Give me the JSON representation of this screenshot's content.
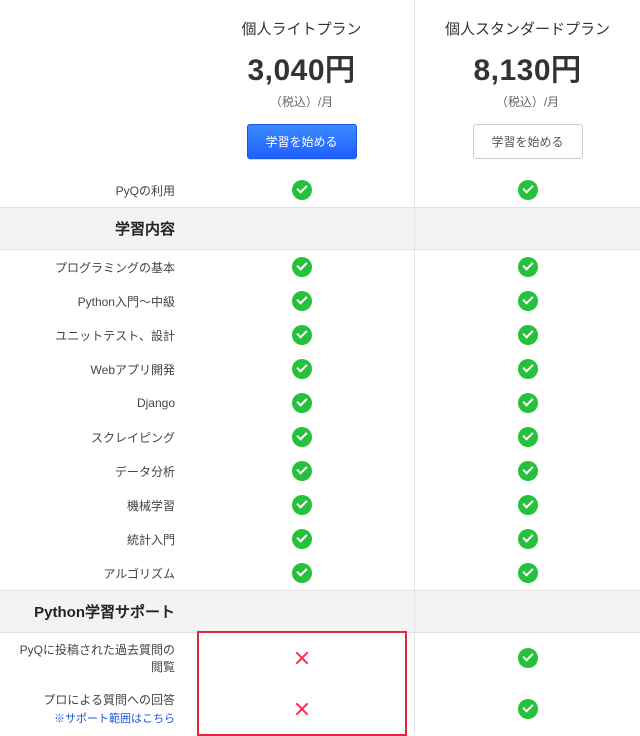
{
  "plans": [
    {
      "name": "個人ライトプラン",
      "price": "3,040円",
      "tax_note": "（税込）/月",
      "cta_label": "学習を始める",
      "cta_style": "primary"
    },
    {
      "name": "個人スタンダードプラン",
      "price": "8,130円",
      "tax_note": "（税込）/月",
      "cta_label": "学習を始める",
      "cta_style": "secondary"
    }
  ],
  "rows": [
    {
      "kind": "feature",
      "label": "PyQの利用",
      "cells": [
        "check",
        "check"
      ]
    },
    {
      "kind": "section",
      "label": "学習内容"
    },
    {
      "kind": "feature",
      "label": "プログラミングの基本",
      "cells": [
        "check",
        "check"
      ]
    },
    {
      "kind": "feature",
      "label": "Python入門〜中級",
      "cells": [
        "check",
        "check"
      ]
    },
    {
      "kind": "feature",
      "label": "ユニットテスト、設計",
      "cells": [
        "check",
        "check"
      ]
    },
    {
      "kind": "feature",
      "label": "Webアプリ開発",
      "cells": [
        "check",
        "check"
      ]
    },
    {
      "kind": "feature",
      "label": "Django",
      "cells": [
        "check",
        "check"
      ]
    },
    {
      "kind": "feature",
      "label": "スクレイピング",
      "cells": [
        "check",
        "check"
      ]
    },
    {
      "kind": "feature",
      "label": "データ分析",
      "cells": [
        "check",
        "check"
      ]
    },
    {
      "kind": "feature",
      "label": "機械学習",
      "cells": [
        "check",
        "check"
      ]
    },
    {
      "kind": "feature",
      "label": "統計入門",
      "cells": [
        "check",
        "check"
      ]
    },
    {
      "kind": "feature",
      "label": "アルゴリズム",
      "cells": [
        "check",
        "check"
      ]
    },
    {
      "kind": "section",
      "label": "Python学習サポート"
    },
    {
      "kind": "feature",
      "label": "PyQに投稿された過去質問の閲覧",
      "cells": [
        "cross",
        "check"
      ],
      "highlight_col": 0
    },
    {
      "kind": "feature",
      "label": "プロによる質問への回答",
      "sublink": "※サポート範囲はこちら",
      "cells": [
        "cross",
        "check"
      ],
      "highlight_col": 0
    }
  ]
}
